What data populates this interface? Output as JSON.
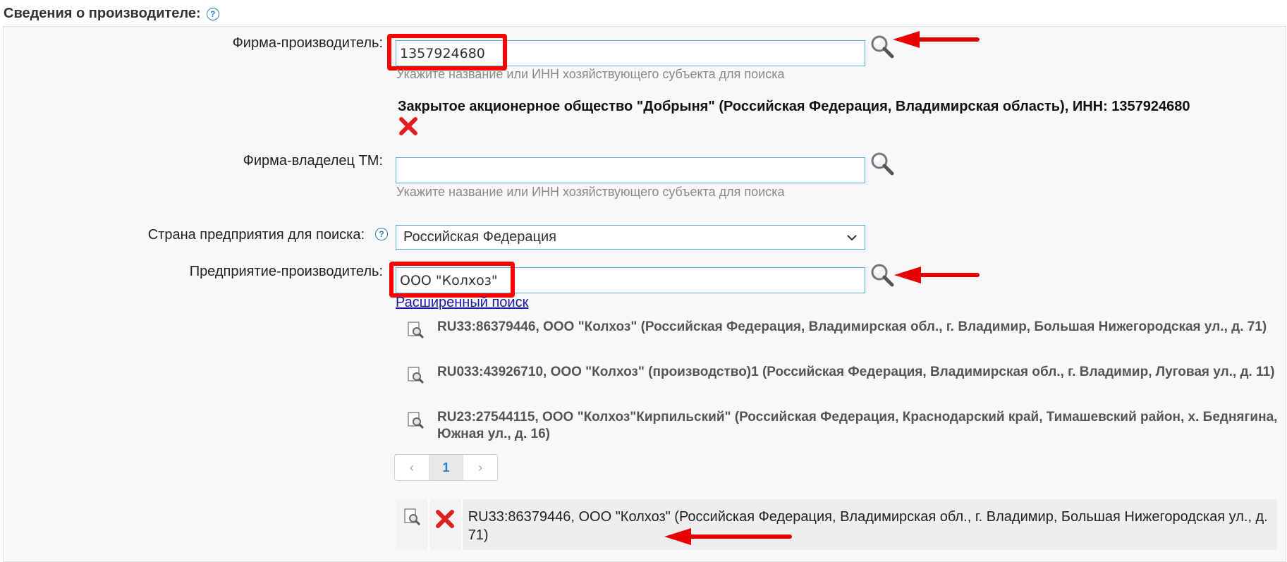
{
  "section": {
    "title": "Сведения о производителе:"
  },
  "firm": {
    "label": "Фирма-производитель:",
    "value": "1357924680",
    "hint": "Укажите название или ИНН хозяйствующего субъекта для поиска",
    "selected": "Закрытое акционерное общество \"Добрыня\" (Российская Федерация, Владимирская область), ИНН: 1357924680"
  },
  "owner": {
    "label": "Фирма-владелец ТМ:",
    "value": "",
    "hint": "Укажите название или ИНН хозяйствующего субъекта для поиска"
  },
  "country": {
    "label": "Страна предприятия для поиска:",
    "selected": "Российская Федерация"
  },
  "enterprise": {
    "label": "Предприятие-производитель:",
    "value": "ООО \"Колхоз\"",
    "advanced_link": "Расширенный поиск",
    "results": [
      "RU33:86379446, ООО \"Колхоз\" (Российская Федерация, Владимирская обл., г. Владимир, Большая Нижегородская ул., д. 71)",
      "RU033:43926710, ООО \"Колхоз\" (производство)1 (Российская Федерация, Владимирская обл., г. Владимир, Луговая ул., д. 11)",
      "RU23:27544115, ООО \"Колхоз\"Кирпильский\" (Российская Федерация, Краснодарский край, Тимашевский район, х. Беднягина, Южная ул., д. 16)"
    ],
    "pager": {
      "prev": "‹",
      "current": "1",
      "next": "›"
    },
    "selected": "RU33:86379446, ООО \"Колхоз\" (Российская Федерация, Владимирская обл., г. Владимир, Большая Нижегородская ул., д. 71)"
  },
  "colors": {
    "accent": "#2a7fc1",
    "highlight": "#ff0000",
    "input_border": "#5aaed8"
  },
  "icons": [
    "help-icon",
    "magnifier-icon",
    "close-icon",
    "document-search-icon",
    "dropdown-chevron-icon"
  ]
}
